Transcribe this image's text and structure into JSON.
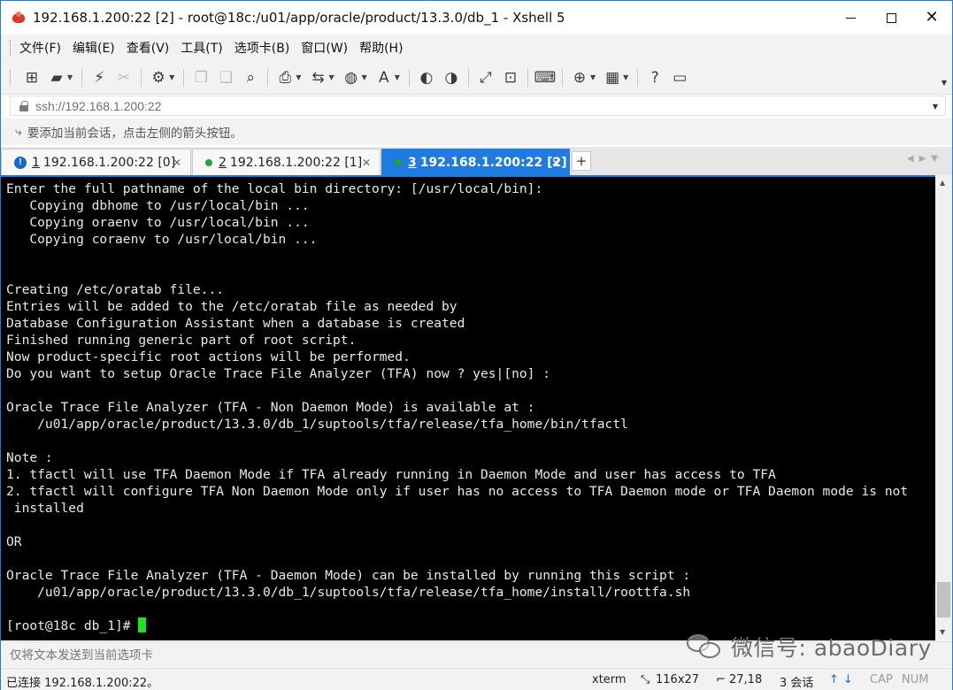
{
  "window": {
    "title": "192.168.1.200:22 [2] - root@18c:/u01/app/oracle/product/13.3.0/db_1 - Xshell 5"
  },
  "menu": [
    "文件(F)",
    "编辑(E)",
    "查看(V)",
    "工具(T)",
    "选项卡(B)",
    "窗口(W)",
    "帮助(H)"
  ],
  "address": {
    "value": "ssh://192.168.1.200:22"
  },
  "hint": {
    "text": "要添加当前会话，点击左侧的箭头按钮。"
  },
  "tabs": [
    {
      "num": "1",
      "label": "192.168.1.200:22 [0]",
      "status": "warning"
    },
    {
      "num": "2",
      "label": "192.168.1.200:22 [1]",
      "status": "connected"
    },
    {
      "num": "3",
      "label": "192.168.1.200:22 [2]",
      "status": "connected",
      "active": true
    }
  ],
  "terminal": {
    "lines": [
      "Enter the full pathname of the local bin directory: [/usr/local/bin]:",
      "   Copying dbhome to /usr/local/bin ...",
      "   Copying oraenv to /usr/local/bin ...",
      "   Copying coraenv to /usr/local/bin ...",
      "",
      "",
      "Creating /etc/oratab file...",
      "Entries will be added to the /etc/oratab file as needed by",
      "Database Configuration Assistant when a database is created",
      "Finished running generic part of root script.",
      "Now product-specific root actions will be performed.",
      "Do you want to setup Oracle Trace File Analyzer (TFA) now ? yes|[no] :",
      "",
      "Oracle Trace File Analyzer (TFA - Non Daemon Mode) is available at :",
      "    /u01/app/oracle/product/13.3.0/db_1/suptools/tfa/release/tfa_home/bin/tfactl",
      "",
      "Note :",
      "1. tfactl will use TFA Daemon Mode if TFA already running in Daemon Mode and user has access to TFA",
      "2. tfactl will configure TFA Non Daemon Mode only if user has no access to TFA Daemon mode or TFA Daemon mode is not",
      " installed",
      "",
      "OR",
      "",
      "Oracle Trace File Analyzer (TFA - Daemon Mode) can be installed by running this script :",
      "    /u01/app/oracle/product/13.3.0/db_1/suptools/tfa/release/tfa_home/install/roottfa.sh",
      ""
    ],
    "prompt": "[root@18c db_1]# ",
    "cursor_color": "#22e022",
    "background": "#000000",
    "foreground": "#e8e8e8"
  },
  "sendbar": {
    "placeholder": "仅将文本发送到当前选项卡"
  },
  "status": {
    "connection": "已连接 192.168.1.200:22。",
    "terminal_type": "xterm",
    "size": "116x27",
    "cursor_pos": "27,18",
    "sessions": "3 会话",
    "caps": "CAP",
    "num": "NUM"
  },
  "watermark": {
    "text": "微信号: abaoDiary"
  },
  "colors": {
    "accent": "#1f7be0",
    "tab_dot": "#1fa53a",
    "tab_warning": "#1769c7"
  }
}
